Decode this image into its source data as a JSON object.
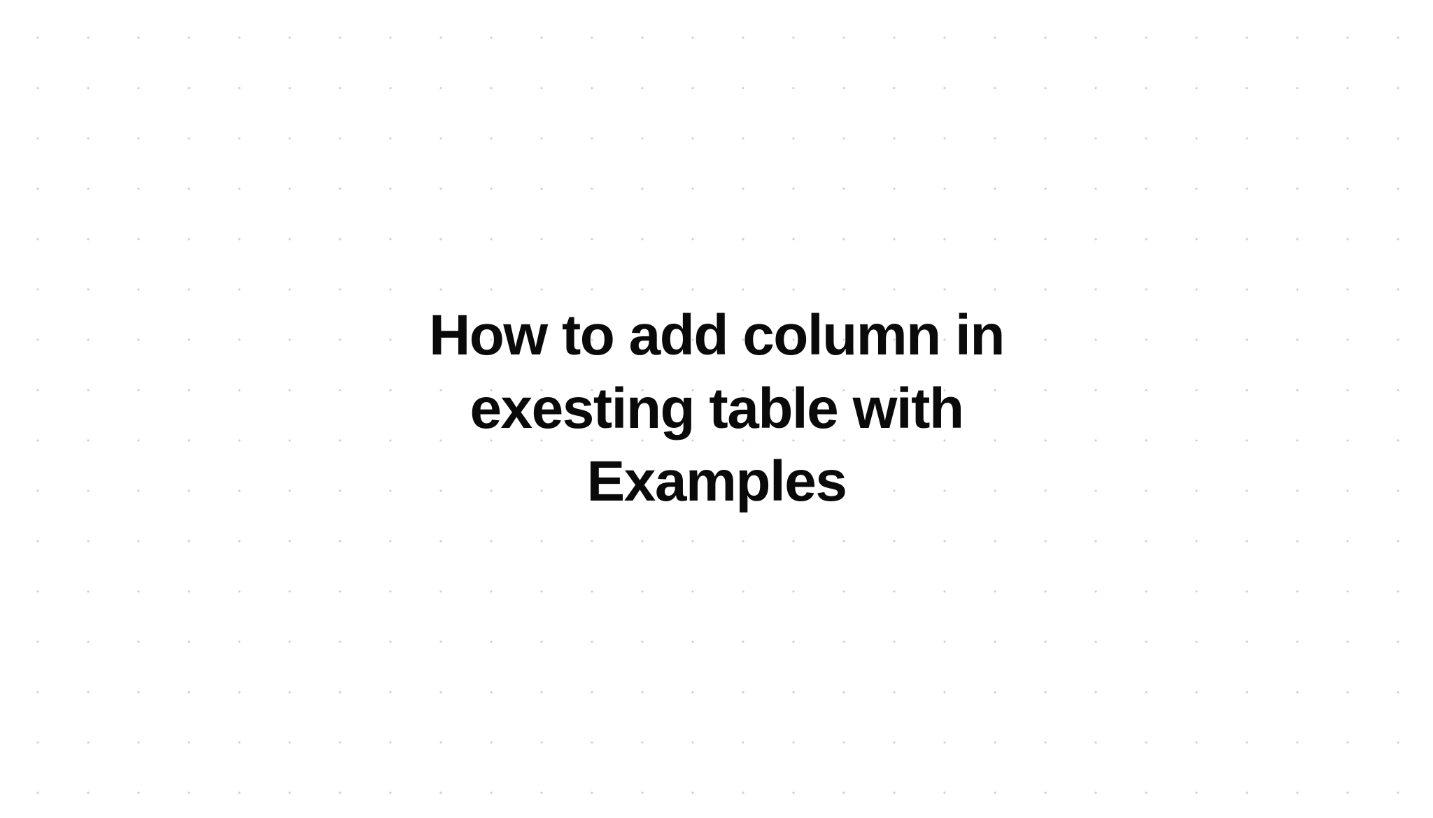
{
  "page": {
    "title": "How to add column in exesting table with Examples"
  }
}
